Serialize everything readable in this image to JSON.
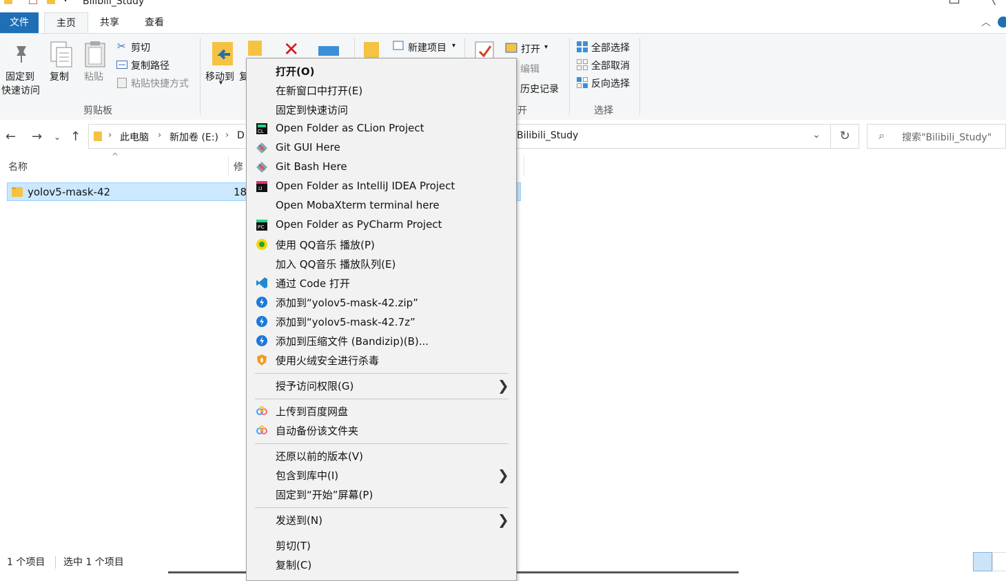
{
  "window": {
    "title": "Bilibili_Study"
  },
  "tabs": {
    "file": "文件",
    "home": "主页",
    "share": "共享",
    "view": "查看"
  },
  "ribbon": {
    "pin_line1": "固定到",
    "pin_line2": "快速访问",
    "copy": "复制",
    "paste": "粘贴",
    "cut": "剪切",
    "copy_path": "复制路径",
    "paste_shortcut": "粘贴快捷方式",
    "clipboard_group": "剪贴板",
    "move_to": "移动到",
    "copy_to_partial": "复",
    "new_item": "新建项目",
    "open": "打开",
    "edit": "编辑",
    "history": "历史记录",
    "open_group_partial": "开",
    "select_all": "全部选择",
    "select_none": "全部取消",
    "invert_selection": "反向选择",
    "select_group": "选择"
  },
  "address": {
    "crumbs": [
      "此电脑",
      "新加卷 (E:)",
      "D",
      "Bilibili_Study"
    ],
    "search_placeholder": "搜索\"Bilibili_Study\""
  },
  "filelist": {
    "col_name": "名称",
    "col_date_partial": "修",
    "rows": [
      {
        "name": "yolov5-mask-42",
        "date_partial": "18"
      }
    ]
  },
  "status": {
    "count": "1 个项目",
    "selected": "选中 1 个项目"
  },
  "context_menu": {
    "items": [
      {
        "label": "打开(O)",
        "bold": true
      },
      {
        "label": "在新窗口中打开(E)"
      },
      {
        "label": "固定到快速访问"
      },
      {
        "label": "Open Folder as CLion Project",
        "icon": "clion-icon"
      },
      {
        "label": "Git GUI Here",
        "icon": "git-icon"
      },
      {
        "label": "Git Bash Here",
        "icon": "git-icon"
      },
      {
        "label": "Open Folder as IntelliJ IDEA Project",
        "icon": "intellij-icon"
      },
      {
        "label": "Open MobaXterm terminal here"
      },
      {
        "label": "Open Folder as PyCharm Project",
        "icon": "pycharm-icon"
      },
      {
        "label": "使用 QQ音乐 播放(P)",
        "icon": "qqmusic-icon"
      },
      {
        "label": "加入 QQ音乐 播放队列(E)"
      },
      {
        "label": "通过 Code 打开",
        "icon": "vscode-icon"
      },
      {
        "label": "添加到“yolov5-mask-42.zip”",
        "icon": "bandizip-icon"
      },
      {
        "label": "添加到“yolov5-mask-42.7z”",
        "icon": "bandizip-icon"
      },
      {
        "label": "添加到压缩文件 (Bandizip)(B)...",
        "icon": "bandizip-icon"
      },
      {
        "label": "使用火绒安全进行杀毒",
        "icon": "huorong-icon"
      },
      {
        "label": "授予访问权限(G)",
        "submenu": true
      },
      {
        "label": "上传到百度网盘",
        "icon": "baidu-netdisk-icon"
      },
      {
        "label": "自动备份该文件夹",
        "icon": "baidu-netdisk-icon"
      },
      {
        "label": "还原以前的版本(V)"
      },
      {
        "label": "包含到库中(I)",
        "submenu": true
      },
      {
        "label": "固定到“开始”屏幕(P)"
      },
      {
        "label": "发送到(N)",
        "submenu": true
      },
      {
        "label": "剪切(T)"
      },
      {
        "label": "复制(C)"
      }
    ],
    "submenu_arrow": "❯"
  },
  "colors": {
    "accent": "#1e6fb5",
    "selection": "#cce8ff",
    "selection_border": "#99d1ff",
    "folder": "#f5c242"
  }
}
